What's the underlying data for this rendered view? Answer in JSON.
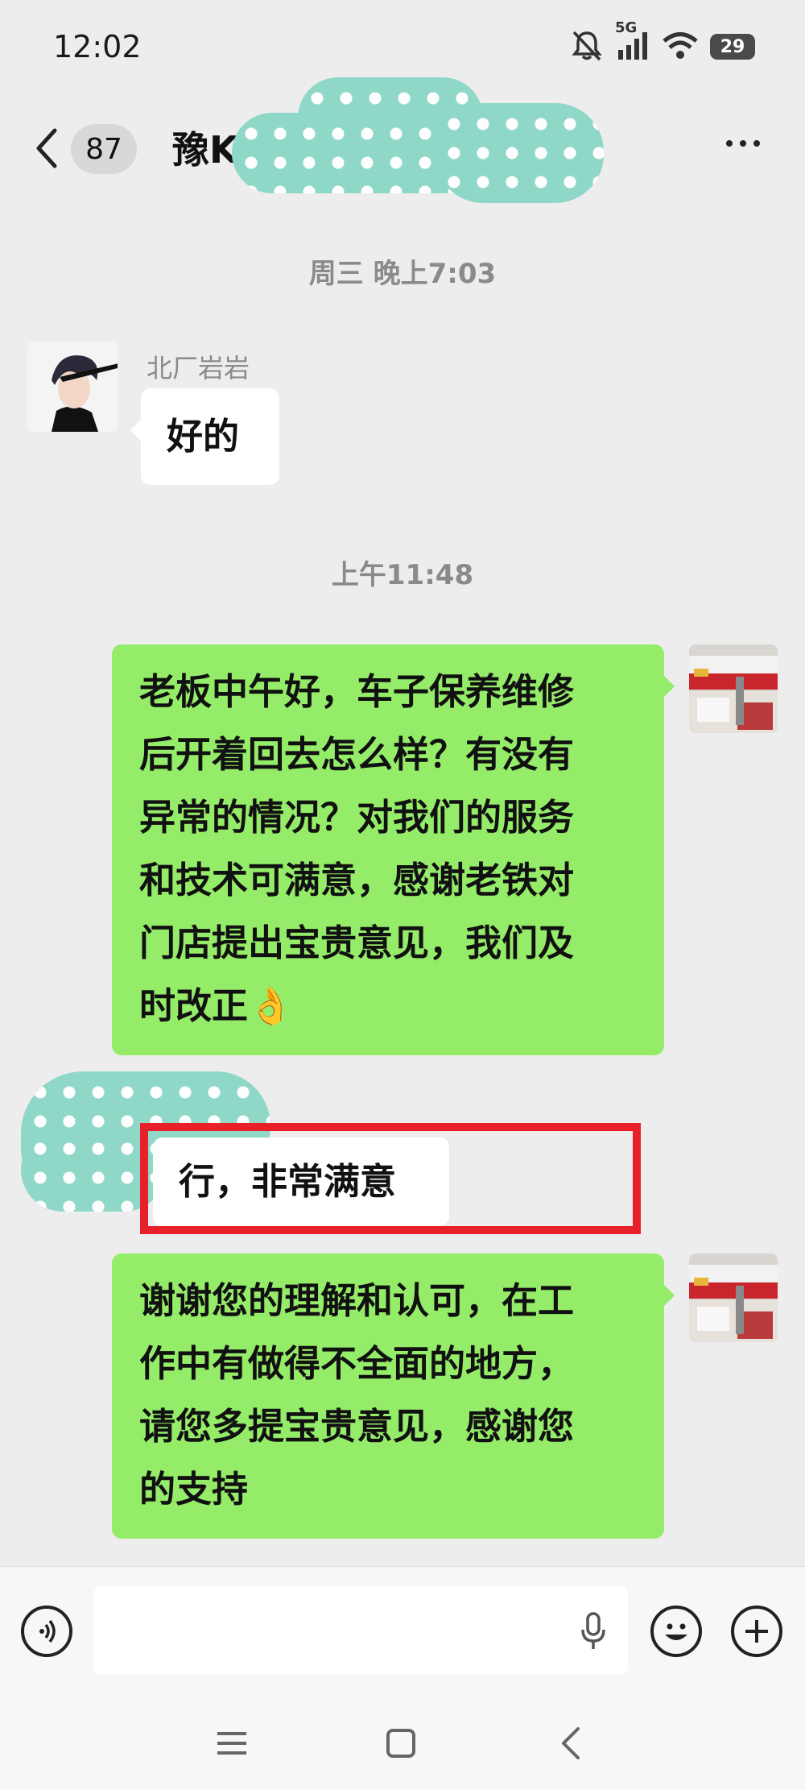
{
  "status_bar": {
    "time": "12:02",
    "network": "5G",
    "battery": "29"
  },
  "nav": {
    "unread_count": "87",
    "chat_title": "豫K"
  },
  "messages": {
    "time_1": "周三 晚上7:03",
    "sender_name": "北厂岩岩",
    "msg_1": "好的",
    "time_2": "上午11:48",
    "msg_2_lines": [
      "老板中午好，车子保养维修",
      "后开着回去怎么样？有没有",
      "异常的情况？对我们的服务",
      "和技术可满意，感谢老铁对",
      "门店提出宝贵意见，我们及",
      "时改正👌"
    ],
    "msg_3": "行，非常满意",
    "msg_4_lines": [
      "谢谢您的理解和认可，在工",
      "作中有做得不全面的地方，",
      "请您多提宝贵意见，感谢您",
      "的支持"
    ]
  },
  "colors": {
    "sent_bubble": "#95ec69",
    "received_bubble": "#ffffff",
    "highlight_box": "#e8202a",
    "background": "#ededed"
  }
}
